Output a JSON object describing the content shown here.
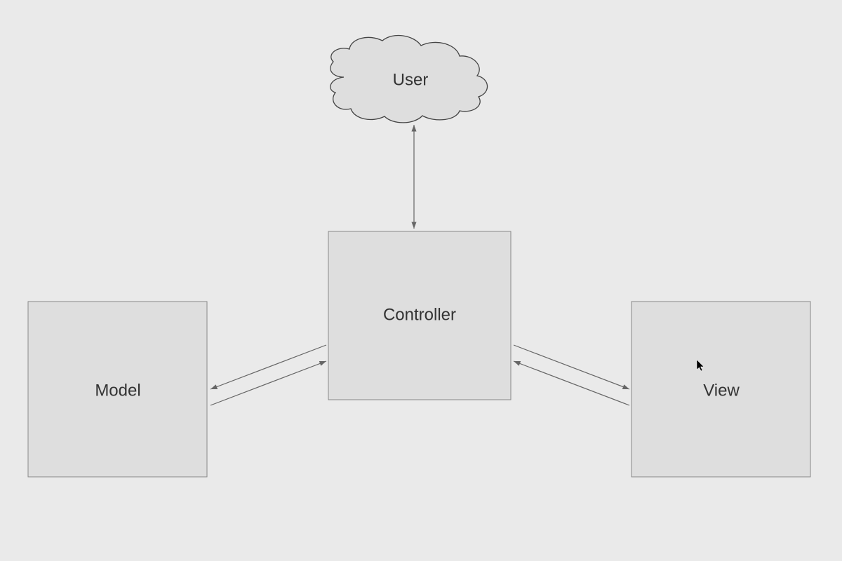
{
  "diagram": {
    "user_label": "User",
    "controller_label": "Controller",
    "model_label": "Model",
    "view_label": "View"
  }
}
